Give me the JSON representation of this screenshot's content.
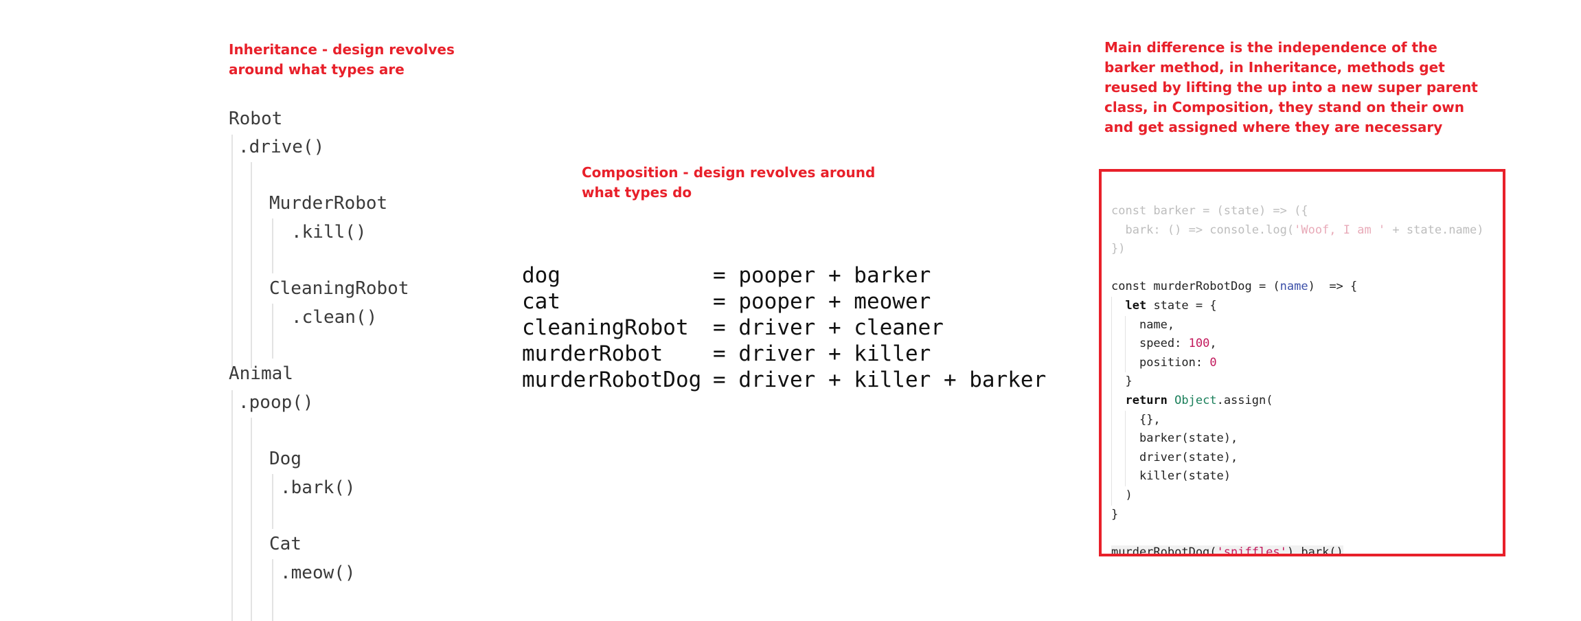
{
  "notes": {
    "inheritance": "Inheritance - design revolves around what types are",
    "composition": "Composition - design revolves around what types do",
    "difference": "Main difference is the independence of the barker method, in Inheritance, methods get reused by lifting the up into a new super parent class, in Composition, they stand on their own and get assigned where they are necessary"
  },
  "inheritance_tree": {
    "robot": "Robot",
    "robot_method": ".drive()",
    "murder_robot": "MurderRobot",
    "murder_robot_method": ".kill()",
    "cleaning_robot": "CleaningRobot",
    "cleaning_robot_method": ".clean()",
    "animal": "Animal",
    "animal_method": ".poop()",
    "dog": "Dog",
    "dog_method": ".bark()",
    "cat": "Cat",
    "cat_method": ".meow()"
  },
  "composition": [
    {
      "name": "dog",
      "formula": "= pooper + barker"
    },
    {
      "name": "cat",
      "formula": "= pooper + meower"
    },
    {
      "name": "cleaningRobot",
      "formula": "= driver + cleaner"
    },
    {
      "name": "murderRobot",
      "formula": "= driver + killer"
    },
    {
      "name": "murderRobotDog",
      "formula": "= driver + killer + barker"
    }
  ],
  "code": {
    "l1_kw": "const",
    "l1_rest": " barker = (state) => ({",
    "l2_pre": "  bark: () => console.log(",
    "l2_str": "'Woof, I am '",
    "l2_post": " + state.name)",
    "l3": "})",
    "l5_kw": "const",
    "l5_mid": " murderRobotDog = (",
    "l5_param": "name",
    "l5_post": ")  => {",
    "l6_kw": "let",
    "l6_rest": " state = {",
    "l7": "name,",
    "l8_pre": "speed: ",
    "l8_num": "100",
    "l8_post": ",",
    "l9_pre": "position: ",
    "l9_num": "0",
    "l10": "}",
    "l11_kw": "return",
    "l11_cls": "Object",
    "l11_post": ".assign(",
    "l12": "{},",
    "l13": "barker(state),",
    "l14": "driver(state),",
    "l15": "killer(state)",
    "l16": ")",
    "l17": "}",
    "l19_pre": "murderRobotDog(",
    "l19_str": "'sniffles'",
    "l19_post": ").bark()"
  }
}
